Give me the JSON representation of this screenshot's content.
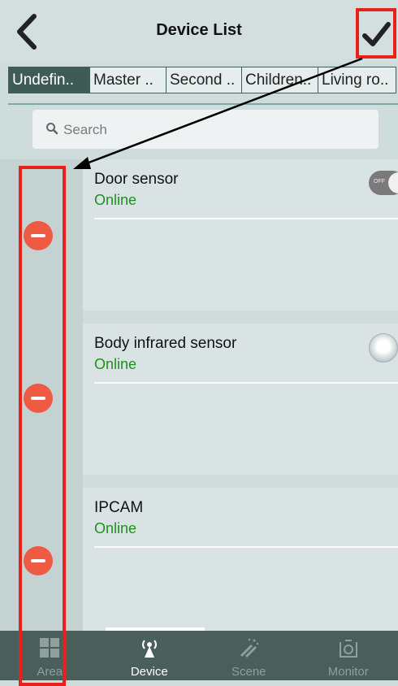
{
  "header": {
    "title": "Device List"
  },
  "tabs": [
    {
      "label": "Undefin.."
    },
    {
      "label": "Master .."
    },
    {
      "label": "Second .."
    },
    {
      "label": "Children.."
    },
    {
      "label": "Living ro.."
    }
  ],
  "search": {
    "placeholder": "Search"
  },
  "devices": [
    {
      "name": "Door sensor",
      "status": "Online",
      "control": "toggle-off",
      "toggle_label": "OFF"
    },
    {
      "name": "Body infrared sensor",
      "status": "Online",
      "control": "round-button"
    },
    {
      "name": "IPCAM",
      "status": "Online",
      "control": "none"
    }
  ],
  "bottom_nav": [
    {
      "label": "Area",
      "icon": "grid-icon"
    },
    {
      "label": "Device",
      "icon": "antenna-icon",
      "active": true
    },
    {
      "label": "Scene",
      "icon": "magic-wand-icon"
    },
    {
      "label": "Monitor",
      "icon": "camera-icon"
    }
  ],
  "colors": {
    "header_bg": "#d3dfdf",
    "tab_active": "#3e5b55",
    "status_online": "#1f8f1f",
    "delete_red": "#ee5a43",
    "highlight_red": "#e8211d",
    "nav_bg": "#4a5e5b"
  }
}
